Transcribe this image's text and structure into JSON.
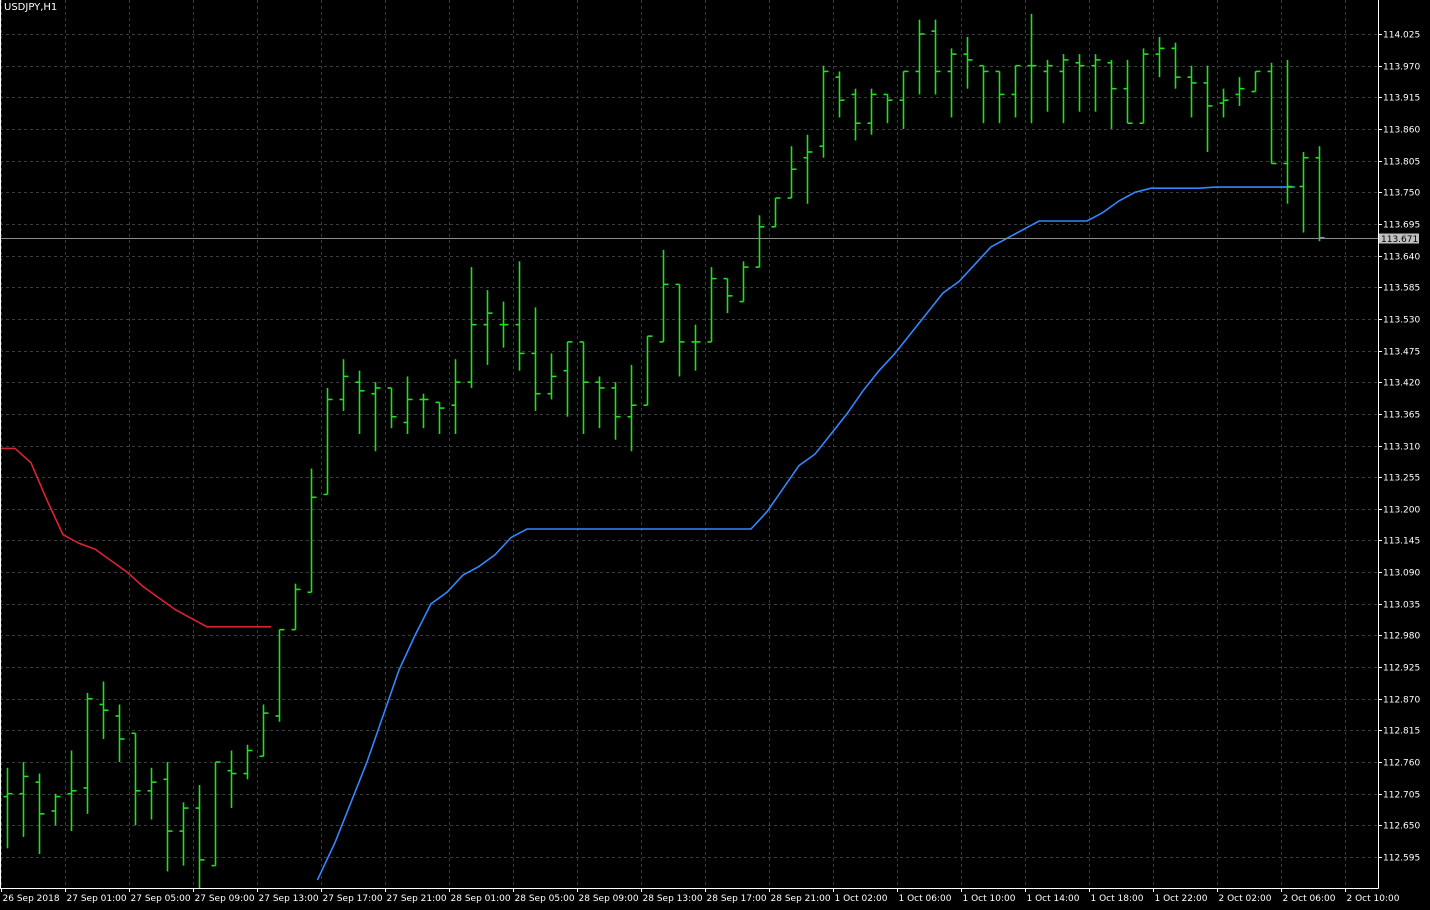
{
  "window": {
    "symbol_title": "USDJPY,H1"
  },
  "colors": {
    "background": "#000000",
    "grid": "#3c3c3c",
    "frame": "#ffffff",
    "axis_text": "#ffffff",
    "bars": "#22dd22",
    "trail_up": "#3388ff",
    "trail_down": "#dd2233",
    "bid_line": "#8c8c8c",
    "price_tag_bg": "#c0c0c0",
    "price_tag_text": "#000000"
  },
  "chart_data": {
    "type": "ohlc",
    "title": "USDJPY,H1",
    "current_price": "113.671",
    "ylim": [
      112.555,
      114.055
    ],
    "grid": true,
    "y_ticks": [
      "114.025",
      "113.970",
      "113.915",
      "113.860",
      "113.805",
      "113.750",
      "113.695",
      "113.640",
      "113.585",
      "113.530",
      "113.475",
      "113.420",
      "113.365",
      "113.310",
      "113.255",
      "113.200",
      "113.145",
      "113.090",
      "113.035",
      "112.980",
      "112.925",
      "112.870",
      "112.815",
      "112.760",
      "112.705",
      "112.650",
      "112.595"
    ],
    "x_ticks": [
      "26 Sep 2018",
      "27 Sep 01:00",
      "27 Sep 05:00",
      "27 Sep 09:00",
      "27 Sep 13:00",
      "27 Sep 17:00",
      "27 Sep 21:00",
      "28 Sep 01:00",
      "28 Sep 05:00",
      "28 Sep 09:00",
      "28 Sep 13:00",
      "28 Sep 17:00",
      "28 Sep 21:00",
      "1 Oct 02:00",
      "1 Oct 06:00",
      "1 Oct 10:00",
      "1 Oct 14:00",
      "1 Oct 18:00",
      "1 Oct 22:00",
      "2 Oct 02:00",
      "2 Oct 06:00",
      "2 Oct 10:00"
    ],
    "bars": [
      [
        112.7,
        112.75,
        112.61,
        112.705
      ],
      [
        112.705,
        112.76,
        112.63,
        112.735
      ],
      [
        112.725,
        112.74,
        112.6,
        112.67
      ],
      [
        112.675,
        112.705,
        112.65,
        112.7
      ],
      [
        112.705,
        112.78,
        112.64,
        112.71
      ],
      [
        112.715,
        112.88,
        112.67,
        112.87
      ],
      [
        112.86,
        112.9,
        112.8,
        112.85
      ],
      [
        112.84,
        112.86,
        112.76,
        112.8
      ],
      [
        112.81,
        112.8,
        112.65,
        112.71
      ],
      [
        112.71,
        112.75,
        112.66,
        112.725
      ],
      [
        112.73,
        112.76,
        112.57,
        112.64
      ],
      [
        112.64,
        112.69,
        112.58,
        112.68
      ],
      [
        112.68,
        112.72,
        112.54,
        112.59
      ],
      [
        112.58,
        112.76,
        112.58,
        112.76
      ],
      [
        112.745,
        112.78,
        112.68,
        112.74
      ],
      [
        112.74,
        112.79,
        112.73,
        112.78
      ],
      [
        112.77,
        112.86,
        112.77,
        112.845
      ],
      [
        112.84,
        112.99,
        112.83,
        112.99
      ],
      [
        112.99,
        113.07,
        113.01,
        113.06
      ],
      [
        113.055,
        113.27,
        113.08,
        113.22
      ],
      [
        113.225,
        113.41,
        113.37,
        113.39
      ],
      [
        113.39,
        113.46,
        113.37,
        113.43
      ],
      [
        113.42,
        113.44,
        113.33,
        113.405
      ],
      [
        113.4,
        113.42,
        113.3,
        113.41
      ],
      [
        113.41,
        113.39,
        113.34,
        113.36
      ],
      [
        113.35,
        113.43,
        113.33,
        113.39
      ],
      [
        113.39,
        113.4,
        113.34,
        113.39
      ],
      [
        113.385,
        113.38,
        113.33,
        113.375
      ],
      [
        113.38,
        113.46,
        113.33,
        113.42
      ],
      [
        113.42,
        113.62,
        113.41,
        113.52
      ],
      [
        113.52,
        113.58,
        113.45,
        113.54
      ],
      [
        113.52,
        113.56,
        113.48,
        113.52
      ],
      [
        113.52,
        113.63,
        113.44,
        113.47
      ],
      [
        113.47,
        113.55,
        113.37,
        113.4
      ],
      [
        113.4,
        113.47,
        113.39,
        113.43
      ],
      [
        113.44,
        113.49,
        113.36,
        113.49
      ],
      [
        113.49,
        113.47,
        113.33,
        113.42
      ],
      [
        113.42,
        113.43,
        113.34,
        113.41
      ],
      [
        113.41,
        113.42,
        113.32,
        113.36
      ],
      [
        113.36,
        113.45,
        113.3,
        113.38
      ],
      [
        113.38,
        113.5,
        113.38,
        113.5
      ],
      [
        113.49,
        113.65,
        113.52,
        113.59
      ],
      [
        113.59,
        113.55,
        113.43,
        113.49
      ],
      [
        113.49,
        113.52,
        113.44,
        113.49
      ],
      [
        113.49,
        113.62,
        113.52,
        113.6
      ],
      [
        113.6,
        113.6,
        113.54,
        113.57
      ],
      [
        113.56,
        113.63,
        113.56,
        113.62
      ],
      [
        113.62,
        113.71,
        113.64,
        113.69
      ],
      [
        113.69,
        113.74,
        113.72,
        113.74
      ],
      [
        113.74,
        113.83,
        113.76,
        113.79
      ],
      [
        113.81,
        113.85,
        113.73,
        113.82
      ],
      [
        113.83,
        113.97,
        113.81,
        113.96
      ],
      [
        113.95,
        113.96,
        113.88,
        113.91
      ],
      [
        113.92,
        113.93,
        113.84,
        113.87
      ],
      [
        113.87,
        113.93,
        113.85,
        113.92
      ],
      [
        113.92,
        113.92,
        113.87,
        113.91
      ],
      [
        113.91,
        113.96,
        113.86,
        113.96
      ],
      [
        113.96,
        114.05,
        113.92,
        114.025
      ],
      [
        114.03,
        114.05,
        113.92,
        113.96
      ],
      [
        113.96,
        114.0,
        113.88,
        113.99
      ],
      [
        113.99,
        114.02,
        113.93,
        113.98
      ],
      [
        113.97,
        113.97,
        113.87,
        113.96
      ],
      [
        113.96,
        113.94,
        113.87,
        113.92
      ],
      [
        113.92,
        113.97,
        113.88,
        113.97
      ],
      [
        113.97,
        114.06,
        113.87,
        113.97
      ],
      [
        113.96,
        113.98,
        113.89,
        113.97
      ],
      [
        113.96,
        113.99,
        113.87,
        113.98
      ],
      [
        113.975,
        113.99,
        113.89,
        113.97
      ],
      [
        113.97,
        113.99,
        113.89,
        113.98
      ],
      [
        113.975,
        113.98,
        113.86,
        113.93
      ],
      [
        113.93,
        113.98,
        113.87,
        113.87
      ],
      [
        113.87,
        114.0,
        113.93,
        113.99
      ],
      [
        113.99,
        114.02,
        113.95,
        114.0
      ],
      [
        114.0,
        114.01,
        113.93,
        113.95
      ],
      [
        113.95,
        113.97,
        113.88,
        113.94
      ],
      [
        113.94,
        113.97,
        113.82,
        113.9
      ],
      [
        113.905,
        113.93,
        113.88,
        113.91
      ],
      [
        113.92,
        113.95,
        113.9,
        113.93
      ],
      [
        113.925,
        113.96,
        113.93,
        113.96
      ],
      [
        113.96,
        113.975,
        113.8,
        113.8
      ],
      [
        113.8,
        113.98,
        113.73,
        113.76
      ],
      [
        113.76,
        113.82,
        113.68,
        113.81
      ],
      [
        113.81,
        113.83,
        113.665,
        113.671
      ]
    ],
    "trail_up": [
      [
        19.4,
        112.555
      ],
      [
        20.5,
        112.62
      ],
      [
        21.5,
        112.69
      ],
      [
        22.5,
        112.76
      ],
      [
        23.5,
        112.84
      ],
      [
        24.5,
        112.92
      ],
      [
        25.5,
        112.98
      ],
      [
        26.5,
        113.035
      ],
      [
        27.5,
        113.055
      ],
      [
        28.5,
        113.085
      ],
      [
        29.5,
        113.1
      ],
      [
        30.5,
        113.12
      ],
      [
        31.5,
        113.15
      ],
      [
        32.5,
        113.165
      ],
      [
        33.5,
        113.165
      ],
      [
        34.5,
        113.165
      ],
      [
        35.5,
        113.165
      ],
      [
        36.5,
        113.165
      ],
      [
        37.5,
        113.165
      ],
      [
        38.5,
        113.165
      ],
      [
        39.5,
        113.165
      ],
      [
        40.5,
        113.165
      ],
      [
        41.5,
        113.165
      ],
      [
        42.5,
        113.165
      ],
      [
        43.5,
        113.165
      ],
      [
        44.5,
        113.165
      ],
      [
        45.5,
        113.165
      ],
      [
        46.5,
        113.165
      ],
      [
        47.5,
        113.195
      ],
      [
        48.5,
        113.235
      ],
      [
        49.5,
        113.275
      ],
      [
        50.5,
        113.295
      ],
      [
        51.5,
        113.33
      ],
      [
        52.5,
        113.365
      ],
      [
        53.5,
        113.405
      ],
      [
        54.5,
        113.44
      ],
      [
        55.5,
        113.47
      ],
      [
        56.5,
        113.505
      ],
      [
        57.5,
        113.54
      ],
      [
        58.5,
        113.575
      ],
      [
        59.5,
        113.595
      ],
      [
        60.5,
        113.625
      ],
      [
        61.5,
        113.655
      ],
      [
        62.5,
        113.67
      ],
      [
        63.5,
        113.685
      ],
      [
        64.5,
        113.7
      ],
      [
        65.5,
        113.7
      ],
      [
        66.5,
        113.7
      ],
      [
        67.5,
        113.7
      ],
      [
        68.5,
        113.715
      ],
      [
        69.5,
        113.735
      ],
      [
        70.5,
        113.75
      ],
      [
        71.5,
        113.757
      ],
      [
        72.5,
        113.757
      ],
      [
        73.5,
        113.757
      ],
      [
        74.5,
        113.757
      ],
      [
        75.5,
        113.759
      ],
      [
        76.5,
        113.759
      ],
      [
        77.5,
        113.759
      ],
      [
        78.5,
        113.759
      ],
      [
        79.5,
        113.759
      ],
      [
        80.5,
        113.759
      ]
    ],
    "trail_down": [
      [
        -0.4,
        113.305
      ],
      [
        0.5,
        113.305
      ],
      [
        1.5,
        113.28
      ],
      [
        2.5,
        113.215
      ],
      [
        3.5,
        113.155
      ],
      [
        4.5,
        113.14
      ],
      [
        5.5,
        113.13
      ],
      [
        6.5,
        113.11
      ],
      [
        7.5,
        113.09
      ],
      [
        8.5,
        113.065
      ],
      [
        9.5,
        113.045
      ],
      [
        10.5,
        113.025
      ],
      [
        11.5,
        113.01
      ],
      [
        12.5,
        112.995
      ],
      [
        13.5,
        112.995
      ],
      [
        14.5,
        112.995
      ],
      [
        15.5,
        112.995
      ],
      [
        16.5,
        112.995
      ]
    ]
  }
}
